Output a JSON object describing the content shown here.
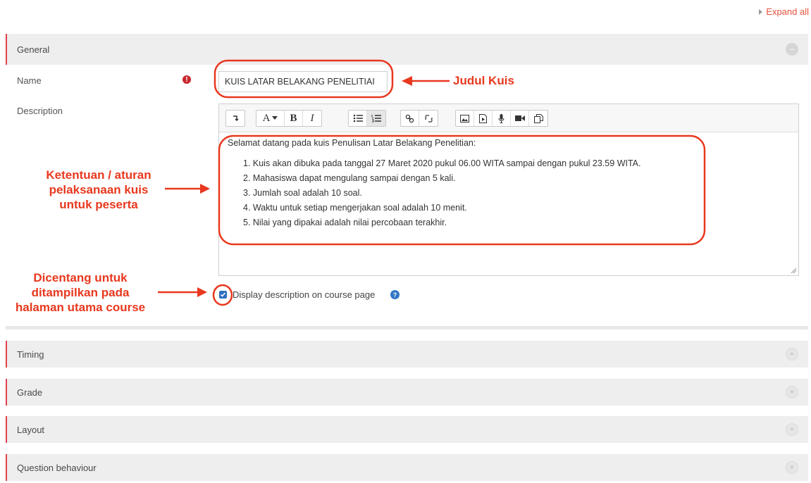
{
  "header": {
    "expand_all": "Expand all"
  },
  "sections": {
    "general": {
      "title": "General"
    },
    "timing": {
      "title": "Timing"
    },
    "grade": {
      "title": "Grade"
    },
    "layout": {
      "title": "Layout"
    },
    "question_behaviour": {
      "title": "Question behaviour"
    }
  },
  "form": {
    "name_label": "Name",
    "name_value": "KUIS LATAR BELAKANG PENELITIAI",
    "required_icon": "!",
    "description_label": "Description",
    "description": {
      "intro": "Selamat datang pada kuis Penulisan Latar Belakang Penelitian:",
      "items": [
        "1. Kuis akan dibuka pada tanggal 27 Maret 2020 pukul 06.00 WITA sampai dengan pukul 23.59 WITA.",
        "2. Mahasiswa dapat mengulang sampai dengan 5 kali.",
        "3. Jumlah soal adalah 10 soal.",
        "4. Waktu untuk setiap mengerjakan soal adalah 10 menit.",
        "5. Nilai yang dipakai adalah nilai percobaan terakhir."
      ]
    },
    "display_description_label": "Display description on course page",
    "display_description_checked": true,
    "help_icon": "?"
  },
  "toolbar": {
    "groups": [
      [
        "collapse-icon"
      ],
      [
        "font-style-icon",
        "bold-icon",
        "italic-icon"
      ],
      [
        "unordered-list-icon",
        "ordered-list-icon"
      ],
      [
        "link-icon",
        "unlink-icon"
      ],
      [
        "image-icon",
        "media-icon",
        "record-audio-icon",
        "record-video-icon",
        "manage-files-icon"
      ]
    ],
    "font_label": "A",
    "bold_label": "B",
    "italic_label": "I"
  },
  "annotations": {
    "judul": "Judul Kuis",
    "ketentuan": [
      "Ketentuan / aturan",
      "pelaksanaan kuis",
      "untuk peserta"
    ],
    "dicentang": [
      "Dicentang untuk",
      "ditampilkan pada",
      "halaman utama course"
    ]
  },
  "colors": {
    "accent": "#e0414b",
    "annotation": "#e8381e",
    "section_bg": "#eeeeee",
    "checkbox": "#2f6fbf"
  }
}
